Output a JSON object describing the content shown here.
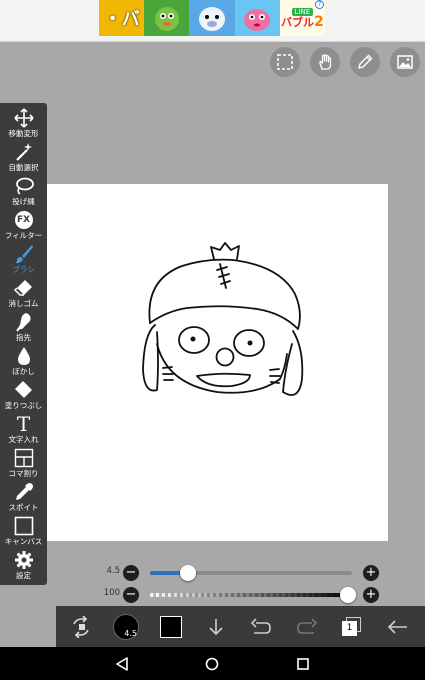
{
  "ad": {
    "tiles": [
      "・バ",
      "",
      "",
      "",
      ""
    ],
    "line_logo": "LINE",
    "bubble_title": "バブル",
    "bubble_num": "2",
    "info_mark": "?"
  },
  "top_actions": [
    "select-icon",
    "hand-icon",
    "pen-icon",
    "image-icon"
  ],
  "toolbar": {
    "items": [
      {
        "label": "移動変形",
        "icon": "move-icon"
      },
      {
        "label": "自動選択",
        "icon": "magic-wand-icon"
      },
      {
        "label": "投げ縄",
        "icon": "lasso-icon"
      },
      {
        "label": "フィルター",
        "icon": "fx-icon",
        "icon_text": "FX"
      },
      {
        "label": "ブラシ",
        "icon": "brush-icon",
        "active": true
      },
      {
        "label": "消しゴム",
        "icon": "eraser-icon"
      },
      {
        "label": "指先",
        "icon": "finger-icon"
      },
      {
        "label": "ぼかし",
        "icon": "blur-drop-icon"
      },
      {
        "label": "塗りつぶし",
        "icon": "bucket-icon"
      },
      {
        "label": "文字入れ",
        "icon": "text-icon",
        "icon_text": "T"
      },
      {
        "label": "コマ割り",
        "icon": "frame-divider-icon"
      },
      {
        "label": "スポイト",
        "icon": "eyedropper-icon"
      },
      {
        "label": "キャンバス",
        "icon": "canvas-icon"
      },
      {
        "label": "設定",
        "icon": "gear-icon"
      }
    ]
  },
  "brush_size": {
    "value": "4.5",
    "level": 0.19,
    "minus": "−",
    "plus": "+"
  },
  "opacity": {
    "value": "100",
    "level": 0.98,
    "minus": "−",
    "plus": "+"
  },
  "bottom_bar": {
    "brush_badge": "4.5",
    "color": "#000000",
    "layer_count": "1"
  },
  "colors": {
    "accent": "#3c9ee6",
    "slider_fill": "#2f6fb5",
    "toolbar_bg": "#3c3c3c"
  }
}
